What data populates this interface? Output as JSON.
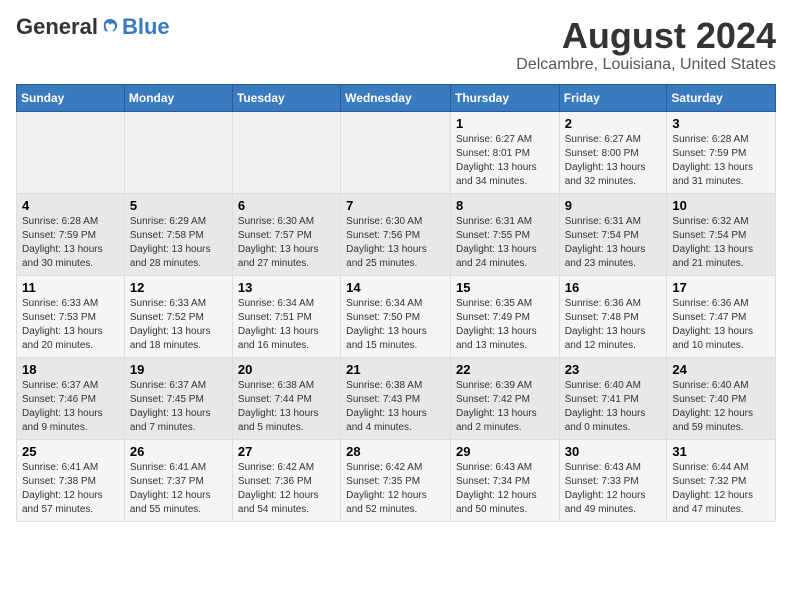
{
  "header": {
    "logo_general": "General",
    "logo_blue": "Blue",
    "main_title": "August 2024",
    "subtitle": "Delcambre, Louisiana, United States"
  },
  "days_of_week": [
    "Sunday",
    "Monday",
    "Tuesday",
    "Wednesday",
    "Thursday",
    "Friday",
    "Saturday"
  ],
  "weeks": [
    [
      {
        "day": "",
        "info": ""
      },
      {
        "day": "",
        "info": ""
      },
      {
        "day": "",
        "info": ""
      },
      {
        "day": "",
        "info": ""
      },
      {
        "day": "1",
        "info": "Sunrise: 6:27 AM\nSunset: 8:01 PM\nDaylight: 13 hours\nand 34 minutes."
      },
      {
        "day": "2",
        "info": "Sunrise: 6:27 AM\nSunset: 8:00 PM\nDaylight: 13 hours\nand 32 minutes."
      },
      {
        "day": "3",
        "info": "Sunrise: 6:28 AM\nSunset: 7:59 PM\nDaylight: 13 hours\nand 31 minutes."
      }
    ],
    [
      {
        "day": "4",
        "info": "Sunrise: 6:28 AM\nSunset: 7:59 PM\nDaylight: 13 hours\nand 30 minutes."
      },
      {
        "day": "5",
        "info": "Sunrise: 6:29 AM\nSunset: 7:58 PM\nDaylight: 13 hours\nand 28 minutes."
      },
      {
        "day": "6",
        "info": "Sunrise: 6:30 AM\nSunset: 7:57 PM\nDaylight: 13 hours\nand 27 minutes."
      },
      {
        "day": "7",
        "info": "Sunrise: 6:30 AM\nSunset: 7:56 PM\nDaylight: 13 hours\nand 25 minutes."
      },
      {
        "day": "8",
        "info": "Sunrise: 6:31 AM\nSunset: 7:55 PM\nDaylight: 13 hours\nand 24 minutes."
      },
      {
        "day": "9",
        "info": "Sunrise: 6:31 AM\nSunset: 7:54 PM\nDaylight: 13 hours\nand 23 minutes."
      },
      {
        "day": "10",
        "info": "Sunrise: 6:32 AM\nSunset: 7:54 PM\nDaylight: 13 hours\nand 21 minutes."
      }
    ],
    [
      {
        "day": "11",
        "info": "Sunrise: 6:33 AM\nSunset: 7:53 PM\nDaylight: 13 hours\nand 20 minutes."
      },
      {
        "day": "12",
        "info": "Sunrise: 6:33 AM\nSunset: 7:52 PM\nDaylight: 13 hours\nand 18 minutes."
      },
      {
        "day": "13",
        "info": "Sunrise: 6:34 AM\nSunset: 7:51 PM\nDaylight: 13 hours\nand 16 minutes."
      },
      {
        "day": "14",
        "info": "Sunrise: 6:34 AM\nSunset: 7:50 PM\nDaylight: 13 hours\nand 15 minutes."
      },
      {
        "day": "15",
        "info": "Sunrise: 6:35 AM\nSunset: 7:49 PM\nDaylight: 13 hours\nand 13 minutes."
      },
      {
        "day": "16",
        "info": "Sunrise: 6:36 AM\nSunset: 7:48 PM\nDaylight: 13 hours\nand 12 minutes."
      },
      {
        "day": "17",
        "info": "Sunrise: 6:36 AM\nSunset: 7:47 PM\nDaylight: 13 hours\nand 10 minutes."
      }
    ],
    [
      {
        "day": "18",
        "info": "Sunrise: 6:37 AM\nSunset: 7:46 PM\nDaylight: 13 hours\nand 9 minutes."
      },
      {
        "day": "19",
        "info": "Sunrise: 6:37 AM\nSunset: 7:45 PM\nDaylight: 13 hours\nand 7 minutes."
      },
      {
        "day": "20",
        "info": "Sunrise: 6:38 AM\nSunset: 7:44 PM\nDaylight: 13 hours\nand 5 minutes."
      },
      {
        "day": "21",
        "info": "Sunrise: 6:38 AM\nSunset: 7:43 PM\nDaylight: 13 hours\nand 4 minutes."
      },
      {
        "day": "22",
        "info": "Sunrise: 6:39 AM\nSunset: 7:42 PM\nDaylight: 13 hours\nand 2 minutes."
      },
      {
        "day": "23",
        "info": "Sunrise: 6:40 AM\nSunset: 7:41 PM\nDaylight: 13 hours\nand 0 minutes."
      },
      {
        "day": "24",
        "info": "Sunrise: 6:40 AM\nSunset: 7:40 PM\nDaylight: 12 hours\nand 59 minutes."
      }
    ],
    [
      {
        "day": "25",
        "info": "Sunrise: 6:41 AM\nSunset: 7:38 PM\nDaylight: 12 hours\nand 57 minutes."
      },
      {
        "day": "26",
        "info": "Sunrise: 6:41 AM\nSunset: 7:37 PM\nDaylight: 12 hours\nand 55 minutes."
      },
      {
        "day": "27",
        "info": "Sunrise: 6:42 AM\nSunset: 7:36 PM\nDaylight: 12 hours\nand 54 minutes."
      },
      {
        "day": "28",
        "info": "Sunrise: 6:42 AM\nSunset: 7:35 PM\nDaylight: 12 hours\nand 52 minutes."
      },
      {
        "day": "29",
        "info": "Sunrise: 6:43 AM\nSunset: 7:34 PM\nDaylight: 12 hours\nand 50 minutes."
      },
      {
        "day": "30",
        "info": "Sunrise: 6:43 AM\nSunset: 7:33 PM\nDaylight: 12 hours\nand 49 minutes."
      },
      {
        "day": "31",
        "info": "Sunrise: 6:44 AM\nSunset: 7:32 PM\nDaylight: 12 hours\nand 47 minutes."
      }
    ]
  ]
}
